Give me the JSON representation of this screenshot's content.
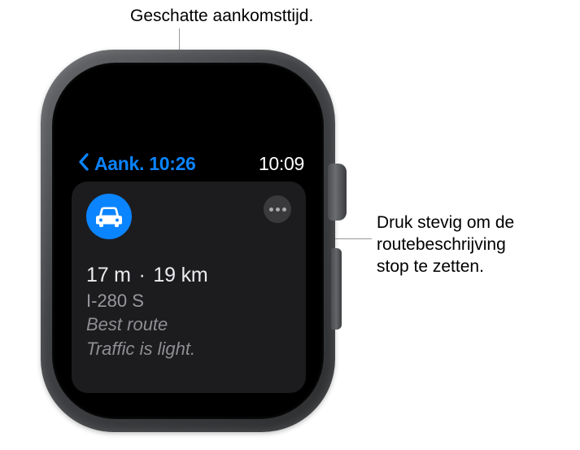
{
  "callouts": {
    "top": "Geschatte aankomsttijd.",
    "right_line1": "Druk stevig om de",
    "right_line2": "routebeschrijving",
    "right_line3": "stop te zetten."
  },
  "status": {
    "arrival_label": "Aank. 10:26",
    "clock": "10:09"
  },
  "route": {
    "duration": "17 m",
    "separator": "·",
    "distance": "19 km",
    "road": "I-280 S",
    "quality": "Best route",
    "traffic": "Traffic is light."
  }
}
